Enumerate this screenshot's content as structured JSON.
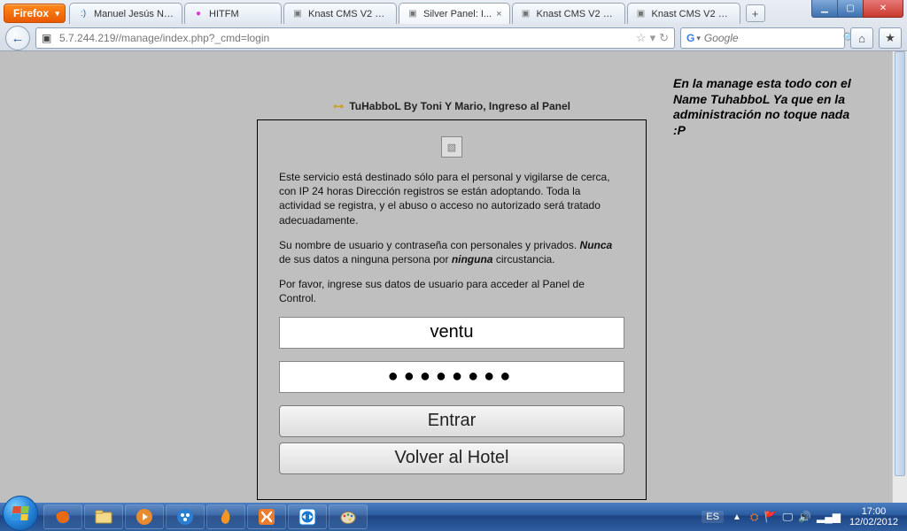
{
  "browser": {
    "product": "Firefox",
    "tabs": [
      {
        "label": "Manuel Jesús Nú...",
        "icon": ":)",
        "icon_class": "fav-smiley"
      },
      {
        "label": "HITFM",
        "icon": "●",
        "icon_class": "fav-dot"
      },
      {
        "label": "Knast CMS V2 Ex...",
        "icon": "▣",
        "icon_class": "fav-cube"
      },
      {
        "label": "Silver Panel: I...",
        "icon": "▣",
        "icon_class": "fav-cube",
        "active": true,
        "closable": true
      },
      {
        "label": "Knast CMS V2 Ex...",
        "icon": "▣",
        "icon_class": "fav-cube"
      },
      {
        "label": "Knast CMS V2 Ex...",
        "icon": "▣",
        "icon_class": "fav-cube"
      }
    ],
    "url": "5.7.244.219//manage/index.php?_cmd=login",
    "search_placeholder": "Google"
  },
  "panel": {
    "title": "TuHabboL By Toni Y Mario, Ingreso al Panel",
    "p1": "Este servicio está destinado sólo para el personal y vigilarse de cerca, con IP 24 horas Dirección registros se están adoptando. Toda la actividad se registra, y el abuso o acceso no autorizado será tratado adecuadamente.",
    "p2a": "Su nombre de usuario y contraseña con personales y privados. ",
    "p2_em1": "Nunca",
    "p2b": " de sus datos a ninguna persona por ",
    "p2_em2": "ninguna",
    "p2c": " circustancia.",
    "p3": "Por favor, ingrese sus datos de usuario para acceder al Panel de Control.",
    "username": "ventu",
    "password_mask": "●●●●●●●●",
    "submit_label": "Entrar",
    "back_label": "Volver al Hotel"
  },
  "side_note": "En la manage esta todo con el Name TuhabboL Ya que en la administración no toque nada :P",
  "taskbar": {
    "lang": "ES",
    "time": "17:00",
    "date": "12/02/2012"
  }
}
